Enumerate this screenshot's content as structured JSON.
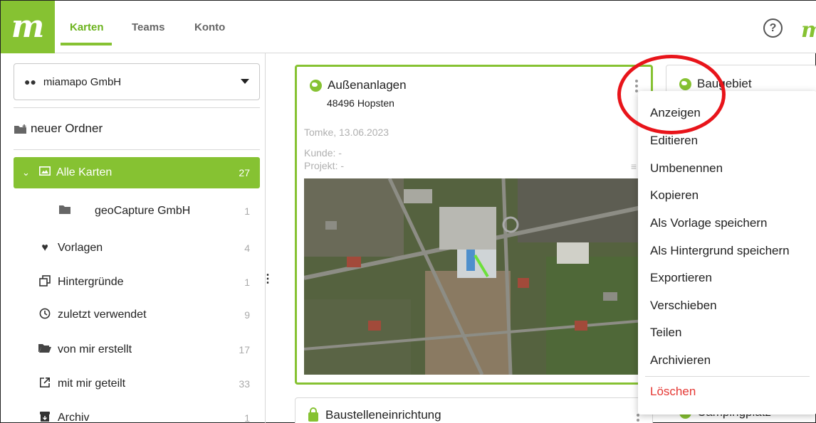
{
  "brand": {
    "logo_letter": "m"
  },
  "nav": {
    "tabs": [
      {
        "label": "Karten"
      },
      {
        "label": "Teams"
      },
      {
        "label": "Konto"
      }
    ],
    "help_glyph": "?"
  },
  "sidebar": {
    "organization": "miamapo GmbH",
    "new_folder_label": "neuer Ordner",
    "items": [
      {
        "label": "Alle Karten",
        "count": "27",
        "icon": "image-icon",
        "active": true
      },
      {
        "label": "geoCapture GmbH",
        "count": "1",
        "icon": "folder-icon"
      },
      {
        "label": "Vorlagen",
        "count": "4",
        "icon": "heart-icon"
      },
      {
        "label": "Hintergründe",
        "count": "1",
        "icon": "layers-icon"
      },
      {
        "label": "zuletzt verwendet",
        "count": "9",
        "icon": "clock-icon"
      },
      {
        "label": "von mir erstellt",
        "count": "17",
        "icon": "folder-open-icon"
      },
      {
        "label": "mit mir geteilt",
        "count": "33",
        "icon": "share-icon"
      },
      {
        "label": "Archiv",
        "count": "1",
        "icon": "archive-icon"
      }
    ]
  },
  "cards": [
    {
      "title": "Außenanlagen",
      "address": "48496 Hopsten",
      "author_date": "Tomke, 13.06.2023",
      "customer": "Kunde: -",
      "project": "Projekt: -"
    },
    {
      "title": "Baugebiet"
    },
    {
      "title": "Baustelleneinrichtung"
    },
    {
      "title": "Campingplatz"
    }
  ],
  "context_menu": {
    "items": [
      {
        "label": "Anzeigen"
      },
      {
        "label": "Editieren"
      },
      {
        "label": "Umbenennen"
      },
      {
        "label": "Kopieren"
      },
      {
        "label": "Als Vorlage speichern"
      },
      {
        "label": "Als Hintergrund speichern"
      },
      {
        "label": "Exportieren"
      },
      {
        "label": "Verschieben"
      },
      {
        "label": "Teilen"
      },
      {
        "label": "Archivieren"
      }
    ],
    "delete_label": "Löschen"
  },
  "colors": {
    "accent": "#86c232",
    "danger": "#e53935",
    "highlight_circle": "#e8141a"
  }
}
